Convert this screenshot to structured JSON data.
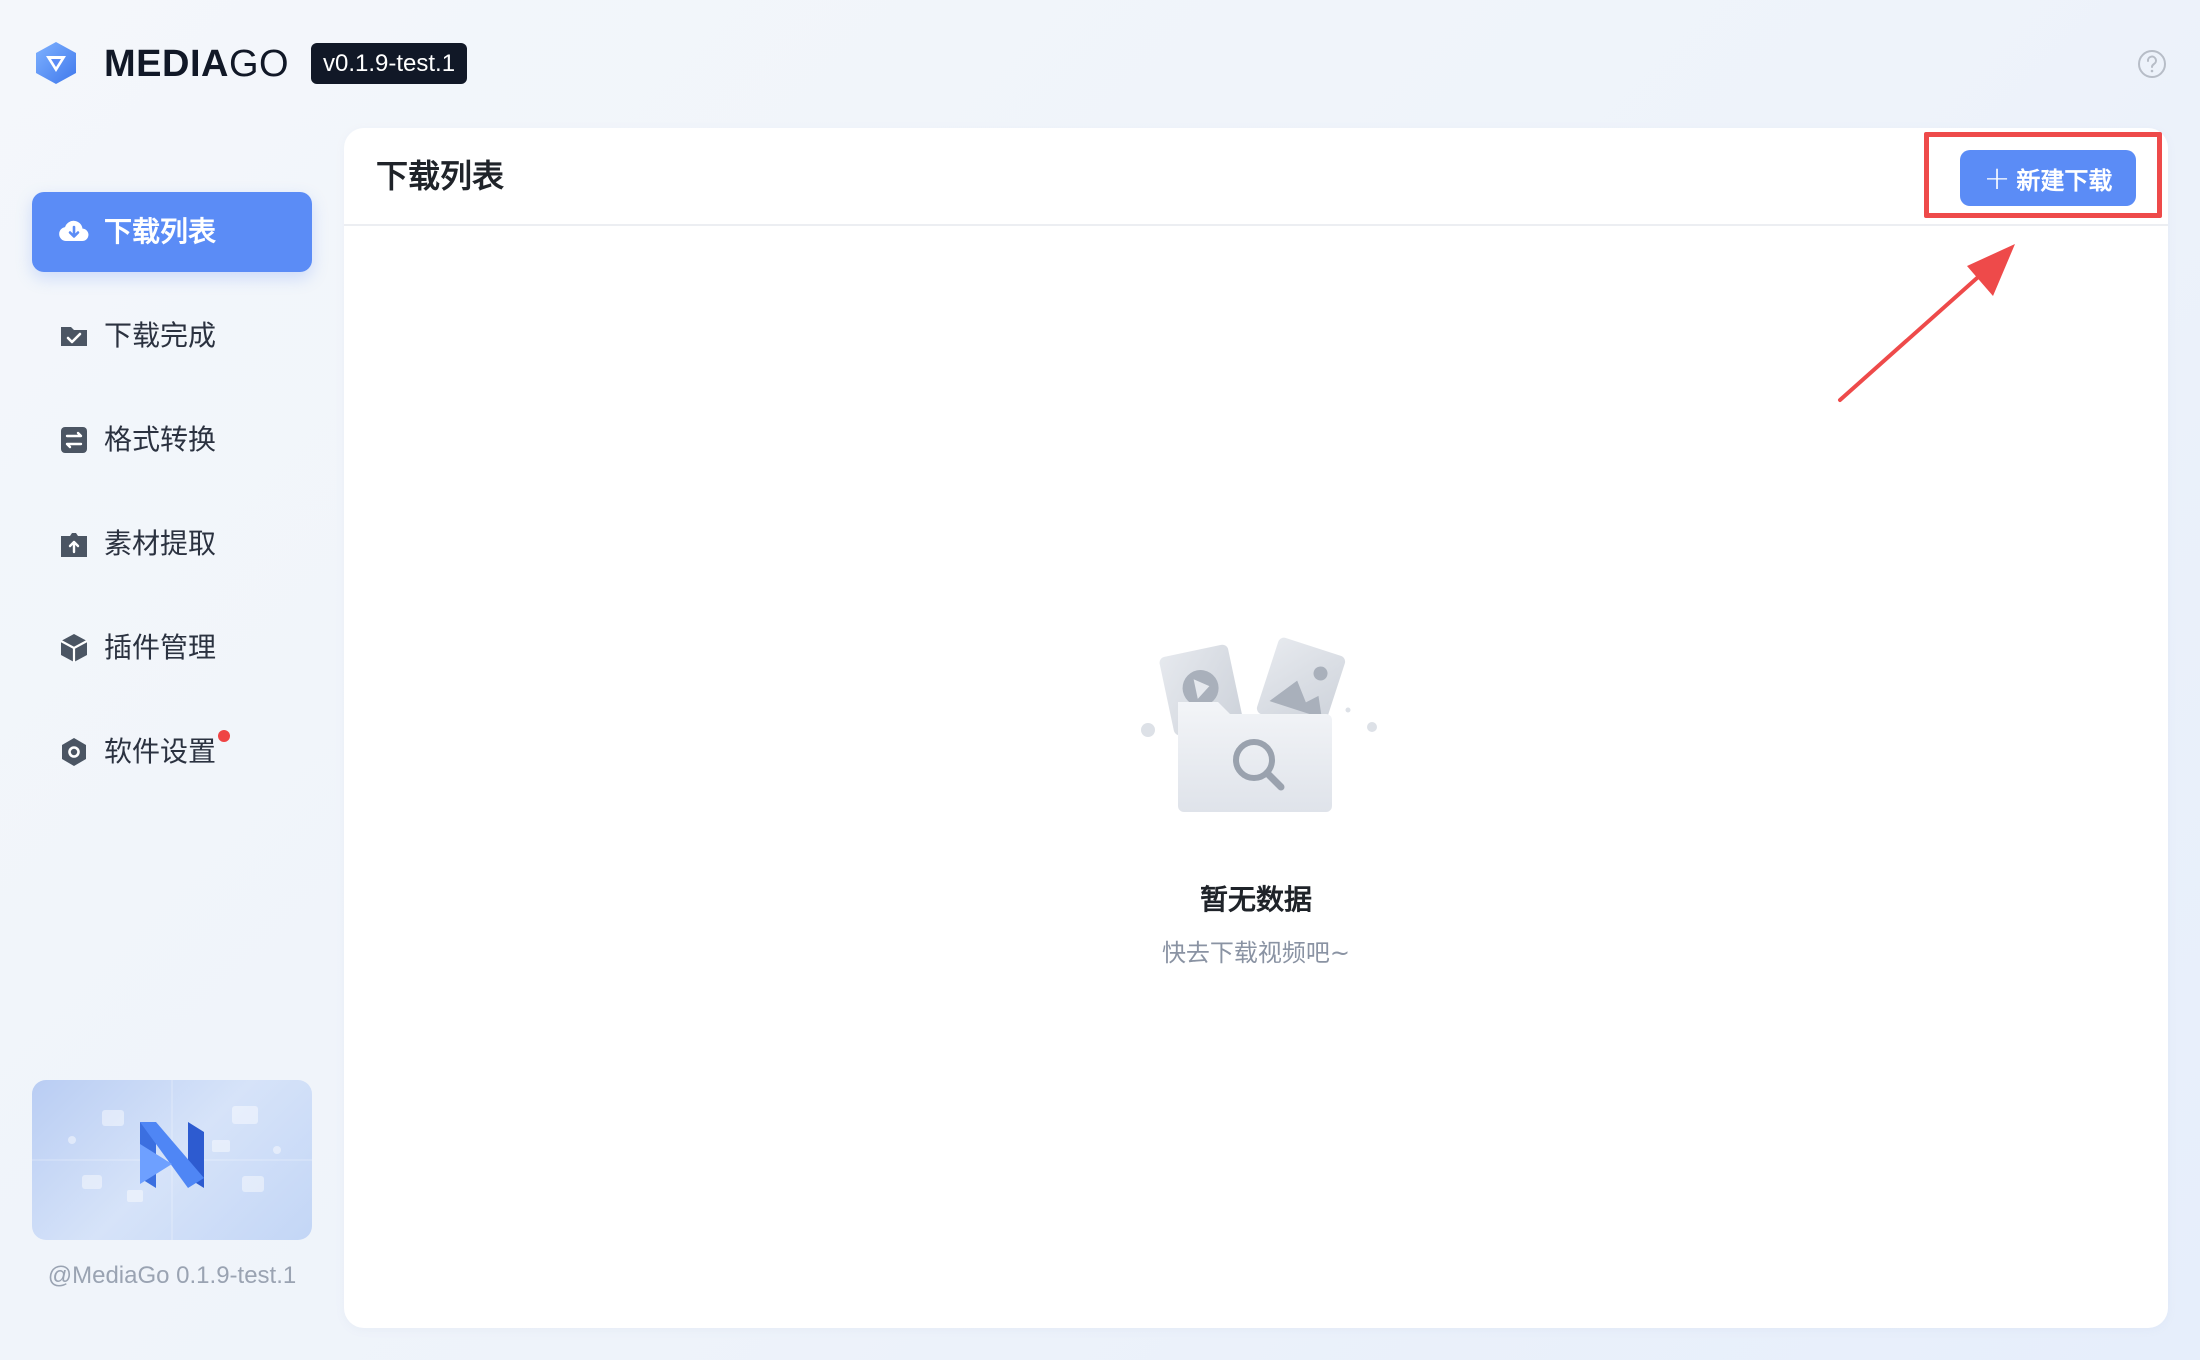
{
  "header": {
    "brand_bold": "MEDIA",
    "brand_light": "GO",
    "version_badge": "v0.1.9-test.1",
    "help_icon": "question-circle-icon"
  },
  "sidebar": {
    "items": [
      {
        "label": "下载列表",
        "icon": "cloud-download-icon",
        "active": true
      },
      {
        "label": "下载完成",
        "icon": "folder-check-icon",
        "active": false
      },
      {
        "label": "格式转换",
        "icon": "swap-icon",
        "active": false
      },
      {
        "label": "素材提取",
        "icon": "upload-box-icon",
        "active": false
      },
      {
        "label": "插件管理",
        "icon": "cube-icon",
        "active": false
      },
      {
        "label": "软件设置",
        "icon": "gear-icon",
        "active": false,
        "badge": "red-dot"
      }
    ],
    "footer_version": "@MediaGo 0.1.9-test.1"
  },
  "main": {
    "title": "下载列表",
    "new_download_label": "新建下载",
    "empty_title": "暂无数据",
    "empty_subtitle": "快去下载视频吧~"
  },
  "colors": {
    "accent": "#5b8cf6",
    "highlight": "#ee4a4a",
    "dark_badge": "#111827"
  }
}
